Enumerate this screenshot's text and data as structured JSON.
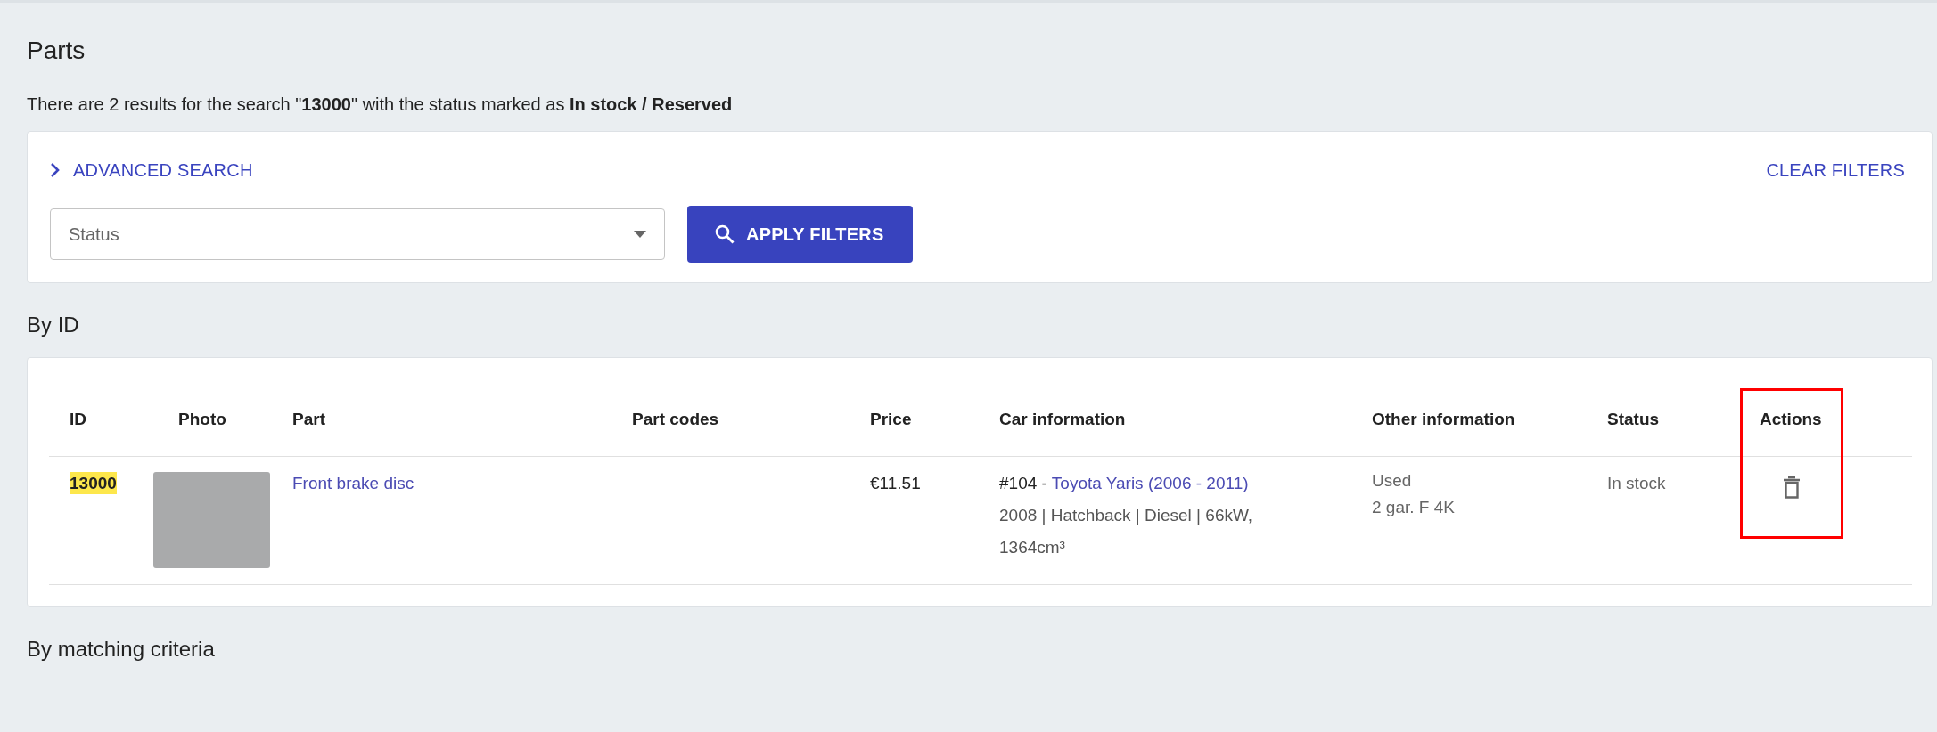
{
  "page": {
    "title": "Parts",
    "summary": "There are 2 results for the search \"**13000**\" with the status marked as **In stock / Reserved**"
  },
  "filters": {
    "advanced_search": {
      "label": "ADVANCED SEARCH",
      "expanded": false
    },
    "clear_filters": "CLEAR FILTERS",
    "status_select": {
      "placeholder": "Status"
    },
    "apply_button": "APPLY FILTERS"
  },
  "sections": [
    {
      "title": "By ID",
      "table": {
        "columns": [
          {
            "label": "ID",
            "outlined": false
          },
          {
            "label": "Photo",
            "outlined": false
          },
          {
            "label": "Part",
            "outlined": false
          },
          {
            "label": "Part codes",
            "outlined": false
          },
          {
            "label": "Price",
            "outlined": false
          },
          {
            "label": "Car information",
            "outlined": false
          },
          {
            "label": "Other information",
            "outlined": false
          },
          {
            "label": "Status",
            "outlined": false
          },
          {
            "label": "Actions",
            "outlined": true
          }
        ],
        "rows": [
          {
            "id": "13000",
            "id_highlighted": true,
            "part": "Front brake disc",
            "price": "€11.51",
            "car_information": {
              "prefix": "#104 -",
              "vehicle": "Toyota Yaris (2006 - 2011)",
              "details": "2008 | Hatchback | Diesel | 66kW, 1364cm³"
            },
            "other_information": [
              "Used",
              "2 gar. F 4K"
            ],
            "status": "In stock"
          }
        ]
      }
    },
    {
      "title": "By matching criteria"
    }
  ]
}
